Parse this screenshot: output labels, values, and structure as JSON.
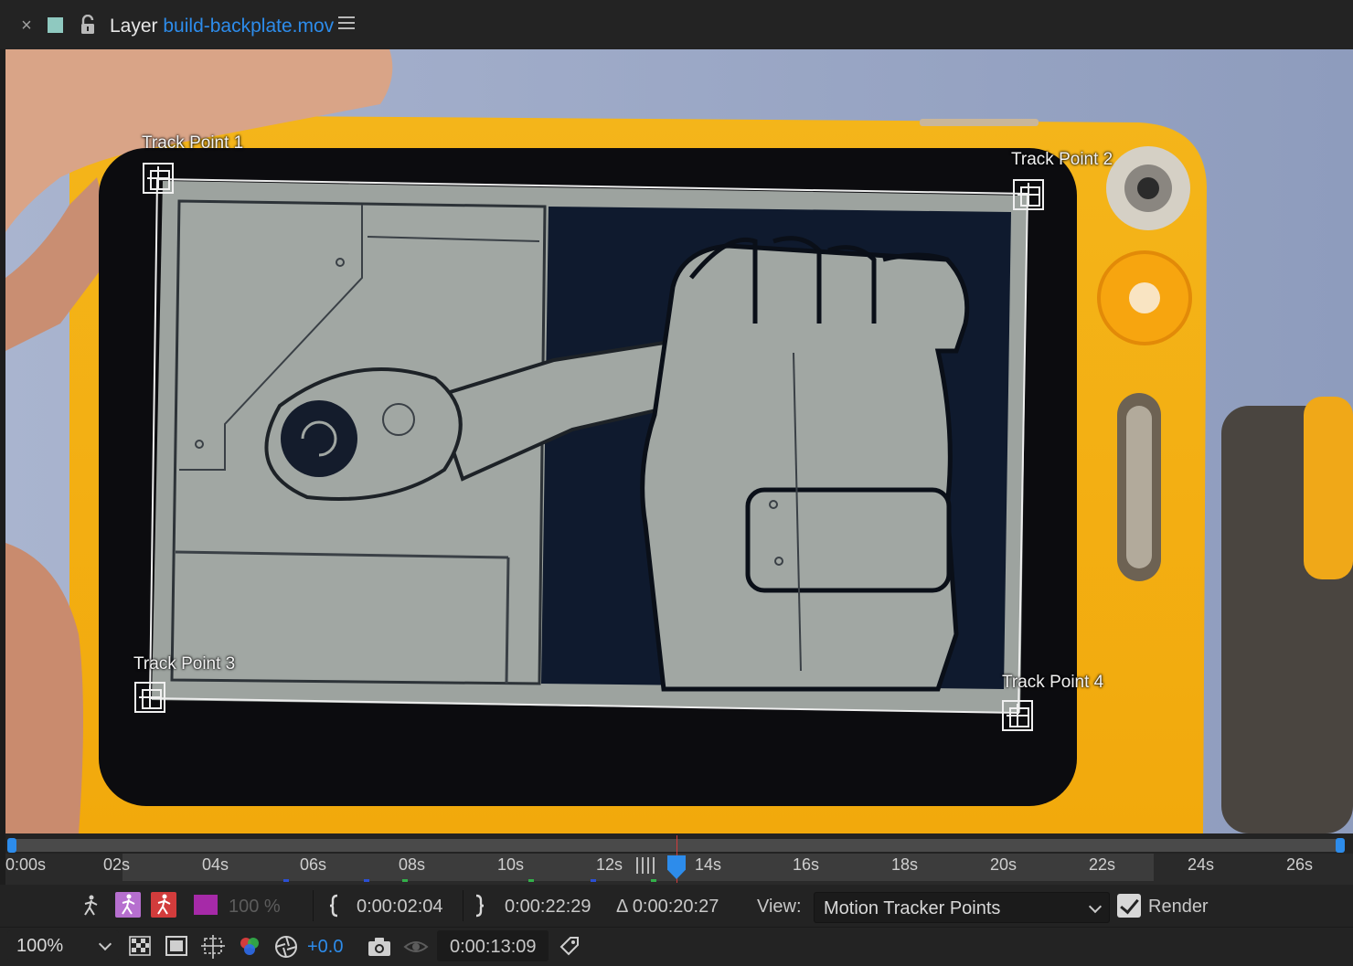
{
  "panel": {
    "close_glyph": "×",
    "layer_prefix": "Layer",
    "layer_name": "build-backplate.mov",
    "label_color": "#8fc9c0",
    "accent_color": "#2d8ceb",
    "icons": [
      "close-icon",
      "lock-icon",
      "panel-menu-icon"
    ]
  },
  "viewer": {
    "track_points": [
      {
        "label": "Track Point 1"
      },
      {
        "label": "Track Point 2"
      },
      {
        "label": "Track Point 3"
      },
      {
        "label": "Track Point 4"
      }
    ]
  },
  "timeline": {
    "ticks": [
      "0:00s",
      "02s",
      "04s",
      "06s",
      "08s",
      "10s",
      "12s",
      "14s",
      "16s",
      "18s",
      "20s",
      "22s",
      "24s",
      "26s"
    ],
    "cti_color": "#2d8ceb",
    "playhead_line_color": "#d23c3c"
  },
  "controls_row1": {
    "opacity": "100 %",
    "in_point": "0:00:02:04",
    "out_point": "0:00:22:29",
    "duration": "Δ 0:00:20:27",
    "view_label": "View:",
    "view_value": "Motion Tracker Points",
    "render_label": "Render",
    "render_checked": true,
    "icons": [
      "motion-path-icon",
      "motion-path-keyframes-icon",
      "motion-path-red-icon",
      "color-swatch-icon",
      "in-point-bracket-icon",
      "out-point-bracket-icon",
      "chevron-down-icon",
      "check-icon"
    ]
  },
  "controls_row2": {
    "zoom": "100%",
    "exposure": "+0.0",
    "current_time": "0:00:13:09",
    "icons": [
      "transparency-grid-icon",
      "region-of-interest-icon",
      "toggle-mask-icon",
      "color-channel-icon",
      "exposure-icon",
      "snapshot-icon",
      "show-snapshot-icon",
      "reset-exposure-icon"
    ]
  }
}
